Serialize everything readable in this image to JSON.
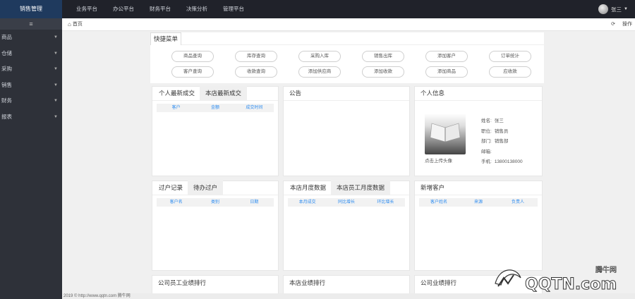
{
  "app": {
    "logo": "销售管理"
  },
  "topnav": [
    "业务平台",
    "办公平台",
    "财务平台",
    "决策分析",
    "管理平台"
  ],
  "user": {
    "name": "张三"
  },
  "sidebar": {
    "toggle": "≡",
    "items": [
      "商品",
      "仓储",
      "采购",
      "销售",
      "财务",
      "报表"
    ]
  },
  "tabbar": {
    "home": "首页",
    "refresh": "⟳",
    "actions": "操作"
  },
  "quick": {
    "title": "快捷菜单",
    "buttons": [
      "商品查询",
      "库存查询",
      "采购入库",
      "销售出库",
      "添加客户",
      "订单统计",
      "客户查询",
      "收款查询",
      "添加供应商",
      "添加收款",
      "添加商品",
      "应收款"
    ]
  },
  "panels": {
    "deals": {
      "tab1": "个人最新成交",
      "tab2": "本店最新成交",
      "cols": [
        "客户",
        "金额",
        "成交时间"
      ]
    },
    "notice": {
      "title": "公告"
    },
    "profile": {
      "title": "个人信息",
      "upload": "点击上传头像",
      "rows": [
        {
          "k": "姓名:",
          "v": "张三"
        },
        {
          "k": "职位:",
          "v": "销售员"
        },
        {
          "k": "部门:",
          "v": "销售部"
        },
        {
          "k": "邮箱:",
          "v": ""
        },
        {
          "k": "手机:",
          "v": "13800138000"
        }
      ]
    },
    "clients": {
      "tab1": "过户记录",
      "tab2": "待办过户",
      "cols": [
        "客户名",
        "类别",
        "日期"
      ]
    },
    "monthly": {
      "tab1": "本店月度数据",
      "tab2": "本店员工月度数据",
      "cols": [
        "本月成交",
        "同比增长",
        "环比增长"
      ]
    },
    "newclients": {
      "title": "新增客户",
      "cols": [
        "客户姓名",
        "来源",
        "负责人"
      ]
    },
    "rank1": {
      "title": "公司员工业绩排行"
    },
    "rank2": {
      "title": "本店业绩排行"
    },
    "rank3": {
      "title": "公司业绩排行"
    }
  },
  "footer": {
    "text": "2019 © http://www.qqtn.com 腾牛网"
  },
  "watermark": {
    "brand": "腾牛网",
    "site": "QQTN.com"
  }
}
